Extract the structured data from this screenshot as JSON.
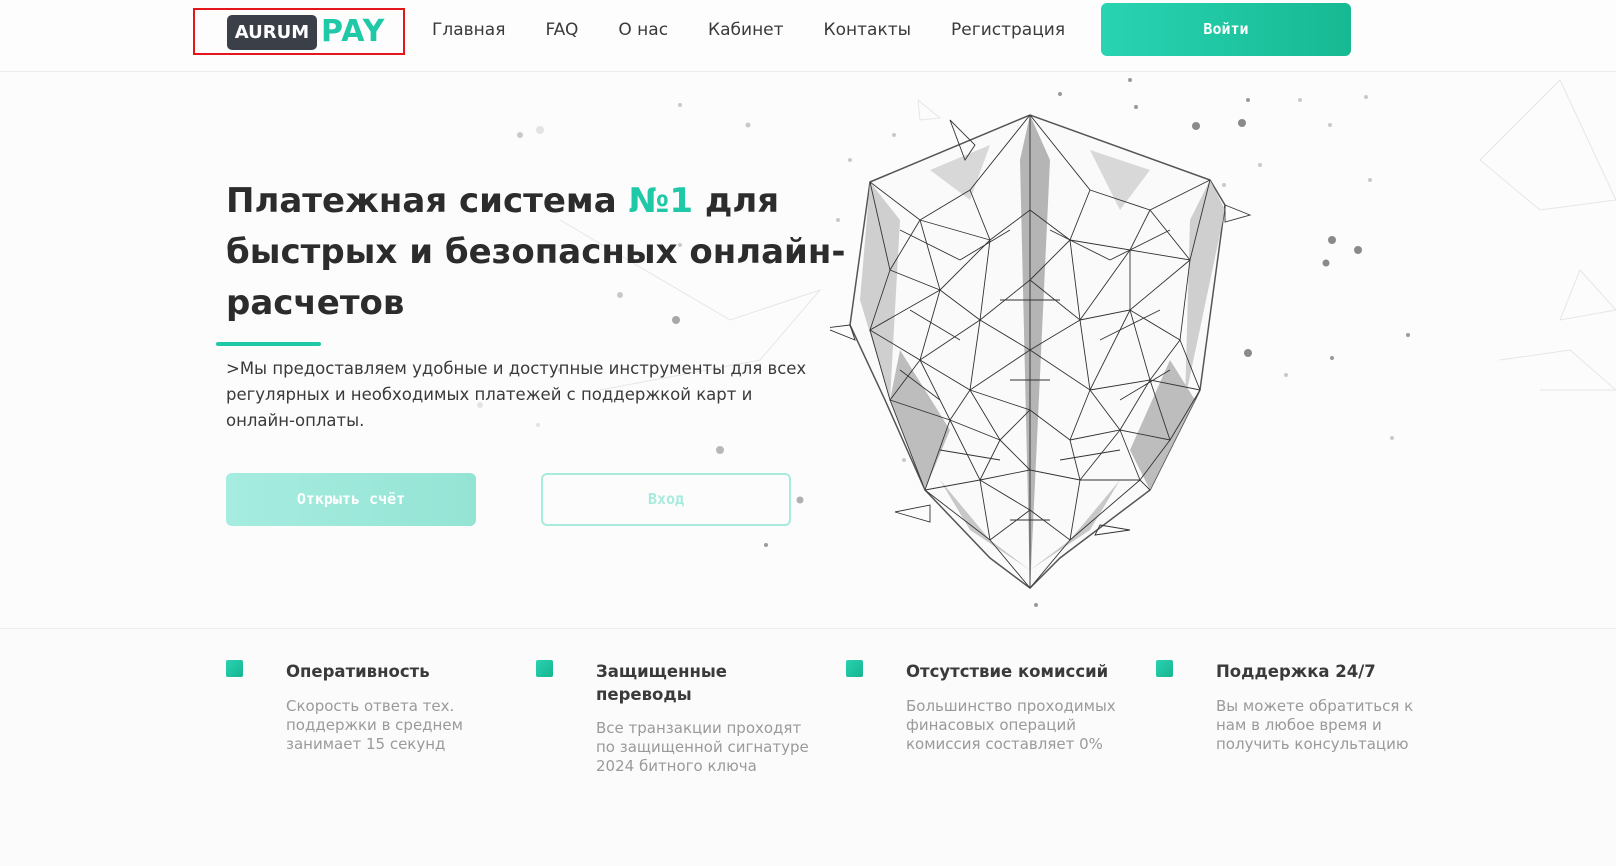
{
  "logo": {
    "part1": "AURUM",
    "part2": "PAY"
  },
  "nav": {
    "items": [
      "Главная",
      "FAQ",
      "О нас",
      "Кабинет",
      "Контакты",
      "Регистрация"
    ],
    "login_button": "Войти"
  },
  "hero": {
    "title_part1": "Платежная система ",
    "title_accent": "№1",
    "title_part2": " для быстрых и безопасных онлайн-расчетов",
    "description": ">Мы предоставляем удобные и доступные инструменты для всех регулярных и необходимых платежей с поддержкой карт и онлайн-оплаты.",
    "open_account_button": "Открыть счёт",
    "enter_button": "Вход"
  },
  "features": [
    {
      "title": "Оперативность",
      "description": "Скорость ответа тех. поддержки в среднем занимает 15 секунд"
    },
    {
      "title": "Защищенные переводы",
      "description": "Все транзакции проходят по защищенной сигнатуре 2024 битного ключа"
    },
    {
      "title": "Отсутствие комиссий",
      "description": "Большинство проходимых финасовых операций комиссия составляет 0%"
    },
    {
      "title": "Поддержка 24/7",
      "description": "Вы можете обратиться к нам в любое время и получить консультацию"
    }
  ],
  "colors": {
    "accent": "#1fc8a6",
    "logo_dark": "#3b3f48",
    "highlight_border": "#e4161b"
  },
  "icons": [
    "polygon-shield-icon",
    "feature-bullet-icon"
  ]
}
